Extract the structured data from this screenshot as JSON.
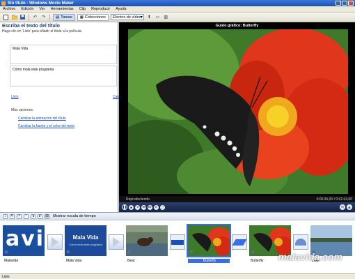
{
  "window": {
    "title": "Sin título - Windows Movie Maker"
  },
  "menu": [
    "Archivo",
    "Edición",
    "Ver",
    "Herramientas",
    "Clip",
    "Reproducir",
    "Ayuda"
  ],
  "toolbar": {
    "tareas_label": "Tareas",
    "colecciones_label": "Colecciones",
    "effects_select": "Efectos de vídeo"
  },
  "taskpane": {
    "title": "Escriba el texto del título",
    "subtitle": "Haga clic en 'Listo' para añadir el título a la película.",
    "line1": "Mala Vida",
    "line2": "Como mola este programa",
    "listo": "Listo",
    "cancelar": "Can",
    "more_options": "Más opciones:",
    "link_animation": "Cambiar la animación del título",
    "link_font": "Cambiar la fuente y el color del texto"
  },
  "preview": {
    "title": "Guión gráfico: Butterfly",
    "status": "Reproduciendo",
    "time": "0:00:36,00 / 0:01:04,00"
  },
  "storyboard": {
    "show_timeline": "Mostrar escala de tiempo",
    "clips": [
      {
        "caption": "Malavida",
        "type": "logo",
        "logo_text": "avi"
      },
      {
        "caption": "Mala Vida",
        "type": "title",
        "title_line1": "Mala Vida",
        "title_line2": "Como mola este programa"
      },
      {
        "caption": "Bear",
        "type": "bear"
      },
      {
        "caption": "Butterfly",
        "type": "butterfly",
        "selected": true
      },
      {
        "caption": "Butterfly",
        "type": "butterfly"
      },
      {
        "caption": "Lake",
        "type": "lake"
      }
    ]
  },
  "watermark": "malavida.com",
  "statusbar": {
    "text": "Listo"
  },
  "colors": {
    "accent": "#3a6ee8",
    "titlebar": "#1c4fb5",
    "preview_bg": "#000000"
  }
}
